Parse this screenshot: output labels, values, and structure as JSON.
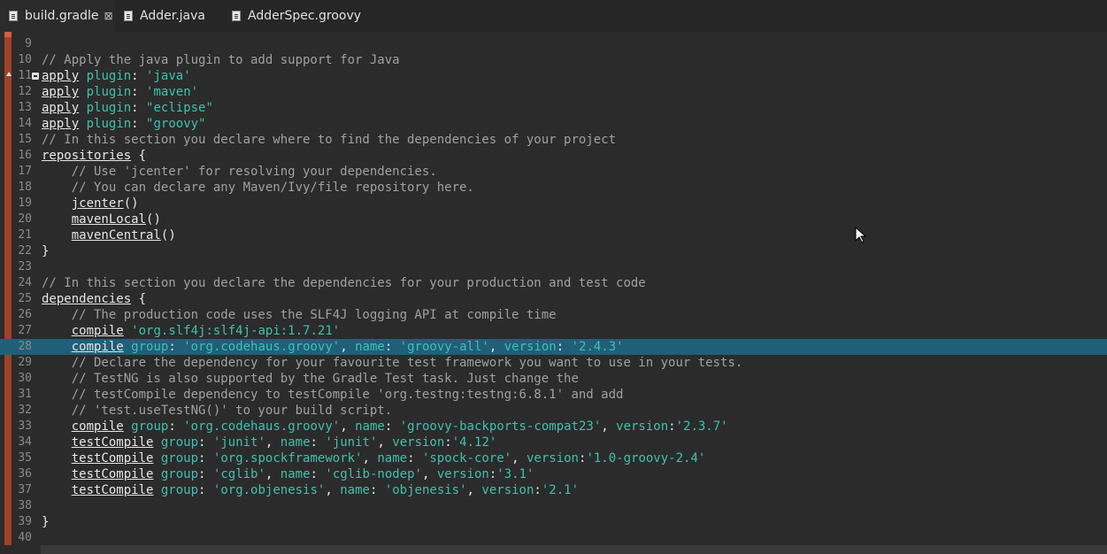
{
  "tabs": [
    {
      "label": "build.gradle",
      "active": true,
      "close": "⊠"
    },
    {
      "label": "Adder.java",
      "active": false
    },
    {
      "label": "AdderSpec.groovy",
      "active": false
    }
  ],
  "lines": [
    {
      "n": "9",
      "code": ""
    },
    {
      "n": "10",
      "code": "// Apply the java plugin to add support for Java"
    },
    {
      "n": "11",
      "code": "apply plugin: 'java'"
    },
    {
      "n": "12",
      "code": "apply plugin: 'maven'"
    },
    {
      "n": "13",
      "code": "apply plugin: \"eclipse\""
    },
    {
      "n": "14",
      "code": "apply plugin: \"groovy\""
    },
    {
      "n": "15",
      "code": "// In this section you declare where to find the dependencies of your project"
    },
    {
      "n": "16",
      "code": "repositories {"
    },
    {
      "n": "17",
      "code": "    // Use 'jcenter' for resolving your dependencies."
    },
    {
      "n": "18",
      "code": "    // You can declare any Maven/Ivy/file repository here."
    },
    {
      "n": "19",
      "code": "    jcenter()"
    },
    {
      "n": "20",
      "code": "    mavenLocal()"
    },
    {
      "n": "21",
      "code": "    mavenCentral()"
    },
    {
      "n": "22",
      "code": "}"
    },
    {
      "n": "23",
      "code": ""
    },
    {
      "n": "24",
      "code": "// In this section you declare the dependencies for your production and test code"
    },
    {
      "n": "25",
      "code": "dependencies {"
    },
    {
      "n": "26",
      "code": "    // The production code uses the SLF4J logging API at compile time"
    },
    {
      "n": "27",
      "code": "    compile 'org.slf4j:slf4j-api:1.7.21'"
    },
    {
      "n": "28",
      "code": "    compile group: 'org.codehaus.groovy', name: 'groovy-all', version: '2.4.3'"
    },
    {
      "n": "29",
      "code": "    // Declare the dependency for your favourite test framework you want to use in your tests."
    },
    {
      "n": "30",
      "code": "    // TestNG is also supported by the Gradle Test task. Just change the"
    },
    {
      "n": "31",
      "code": "    // testCompile dependency to testCompile 'org.testng:testng:6.8.1' and add"
    },
    {
      "n": "32",
      "code": "    // 'test.useTestNG()' to your build script."
    },
    {
      "n": "33",
      "code": "    compile group: 'org.codehaus.groovy', name: 'groovy-backports-compat23', version:'2.3.7'"
    },
    {
      "n": "34",
      "code": "    testCompile group: 'junit', name: 'junit', version:'4.12'"
    },
    {
      "n": "35",
      "code": "    testCompile group: 'org.spockframework', name: 'spock-core', version:'1.0-groovy-2.4'"
    },
    {
      "n": "36",
      "code": "    testCompile group: 'cglib', name: 'cglib-nodep', version:'3.1'"
    },
    {
      "n": "37",
      "code": "    testCompile group: 'org.objenesis', name: 'objenesis', version:'2.1'"
    },
    {
      "n": "38",
      "code": ""
    },
    {
      "n": "39",
      "code": "}"
    },
    {
      "n": "40",
      "code": ""
    }
  ],
  "highlighted_line": "28",
  "colors": {
    "string": "#3fc0b0",
    "comment": "#a0a0a0",
    "selection": "#1f5f7a",
    "ruler": "#a0402a"
  }
}
